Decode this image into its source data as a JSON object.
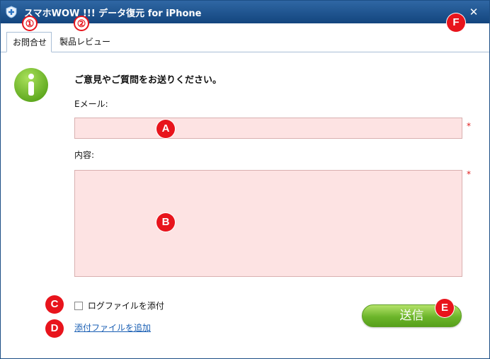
{
  "window": {
    "title": "スマホWOW !!! データ復元 for iPhone",
    "close_label": "✕"
  },
  "tabs": [
    {
      "label": "お問合せ",
      "active": true
    },
    {
      "label": "製品レビュー",
      "active": false
    }
  ],
  "form": {
    "prompt": "ご意見やご質問をお送りください。",
    "email_label": "Eメール:",
    "email_value": "",
    "content_label": "内容:",
    "content_value": "",
    "required_mark": "*",
    "attach_log_label": "ログファイルを添付",
    "attach_log_checked": false,
    "add_attachment_link": "添付ファイルを追加",
    "send_label": "送信"
  },
  "annotations": {
    "numbers": [
      "①",
      "②"
    ],
    "letters": [
      "A",
      "B",
      "C",
      "D",
      "E",
      "F"
    ]
  },
  "colors": {
    "titlebar": "#1d4f86",
    "field_bg": "#fde3e3",
    "send_button": "#6cb52a",
    "marker": "#e8141c",
    "link": "#1a5fb4"
  },
  "icons": {
    "app": "shield-plus-icon",
    "info": "info-icon",
    "close": "close-icon"
  }
}
